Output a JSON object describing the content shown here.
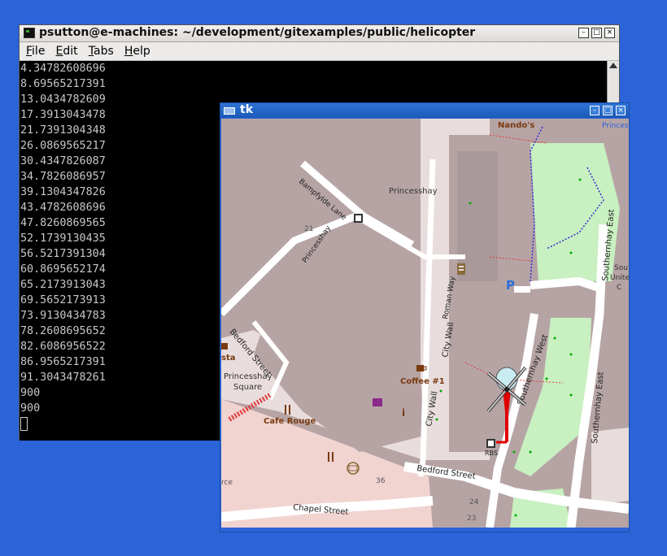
{
  "terminal": {
    "title": "psutton@e-machines: ~/development/gitexamples/public/helicopter",
    "buttons": {
      "minimize": "–",
      "maximize": "□",
      "close": "×"
    },
    "menu": [
      "File",
      "Edit",
      "Tabs",
      "Help"
    ],
    "lines": [
      "4.34782608696",
      "8.69565217391",
      "13.0434782609",
      "17.3913043478",
      "21.7391304348",
      "26.0869565217",
      "30.4347826087",
      "34.7826086957",
      "39.1304347826",
      "43.4782608696",
      "47.8260869565",
      "52.1739130435",
      "56.5217391304",
      "60.8695652174",
      "65.2173913043",
      "69.5652173913",
      "73.9130434783",
      "78.2608695652",
      "82.6086956522",
      "86.9565217391",
      "91.3043478261",
      "900",
      "900"
    ]
  },
  "tk": {
    "title": "tk",
    "buttons": {
      "minimize": "–",
      "maximize": "□",
      "close": "×"
    }
  },
  "map_labels": {
    "nandos": "Nando's",
    "princess_top": "Princess",
    "princesshay": "Princesshay",
    "bampfylde": "Bampfylde Lane",
    "princesshay_diag": "Princesshay",
    "n21": "21",
    "roman_way": "Roman Way",
    "city_wall": "City Wall",
    "city_wall2": "City Wall",
    "southernhay_west": "Southernhay West",
    "southernhay_east": "Southernhay East",
    "southernhay_east2": "Southernhay East",
    "sou": "Sou",
    "unite": "Unite",
    "ccc": "C",
    "bedford_street": "Bedford Street",
    "bedford_street2": "Bedford Street",
    "princesshay_square1": "Princesshay",
    "princesshay_square2": "Square",
    "sta": "sta",
    "coffee": "Coffee #1",
    "cafe_rouge": "Cafe Rouge",
    "rbs": "RBS",
    "chapel_street": "Chapel Street",
    "n36": "36",
    "n24": "24",
    "n23": "23",
    "rce": "rce",
    "parking": "P",
    "info": "i"
  },
  "colors": {
    "desktop": "#2a64d8",
    "building": "#b6a4a5",
    "pedestrian": "#e8dddc",
    "road": "#ffffff",
    "park": "#c8f0c0",
    "helicopter": "#e00000"
  }
}
